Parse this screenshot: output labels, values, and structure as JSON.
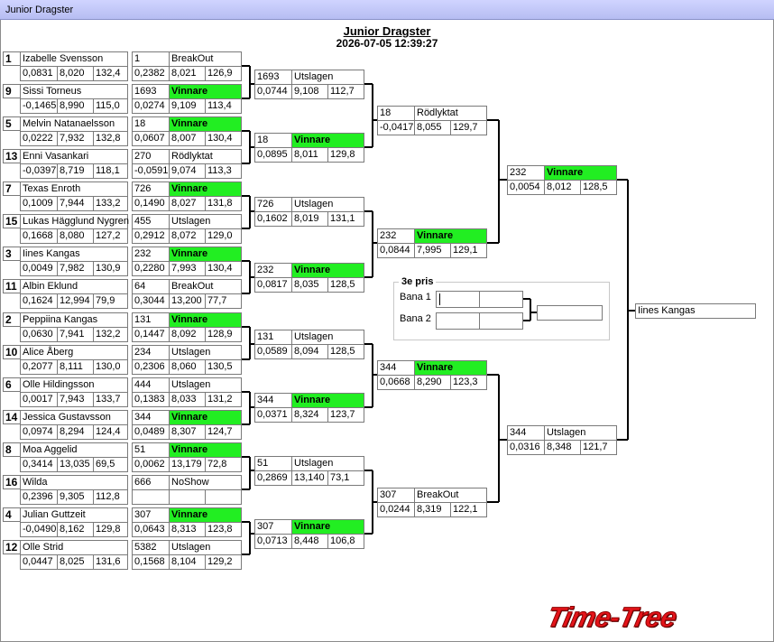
{
  "window": {
    "title": "Junior Dragster"
  },
  "header": {
    "title": "Junior Dragster",
    "datetime": "2026-07-05 12:39:27"
  },
  "round1": [
    {
      "seed": "1",
      "name": "Izabelle Svensson",
      "rt": "0,0831",
      "et": "8,020",
      "speed": "132,4"
    },
    {
      "seed": "9",
      "name": "Sissi Torneus",
      "rt": "-0,1465",
      "et": "8,990",
      "speed": "115,0"
    },
    {
      "seed": "5",
      "name": "Melvin Natanaelsson",
      "rt": "0,0222",
      "et": "7,932",
      "speed": "132,8"
    },
    {
      "seed": "13",
      "name": "Enni Vasankari",
      "rt": "-0,0397",
      "et": "8,719",
      "speed": "118,1"
    },
    {
      "seed": "7",
      "name": "Texas Enroth",
      "rt": "0,1009",
      "et": "7,944",
      "speed": "133,2"
    },
    {
      "seed": "15",
      "name": "Lukas Hägglund Nygren",
      "rt": "0,1668",
      "et": "8,080",
      "speed": "127,2"
    },
    {
      "seed": "3",
      "name": "Iines Kangas",
      "rt": "0,0049",
      "et": "7,982",
      "speed": "130,9"
    },
    {
      "seed": "11",
      "name": "Albin Eklund",
      "rt": "0,1624",
      "et": "12,994",
      "speed": "79,9"
    },
    {
      "seed": "2",
      "name": "Peppiina Kangas",
      "rt": "0,0630",
      "et": "7,941",
      "speed": "132,2"
    },
    {
      "seed": "10",
      "name": "Alice Åberg",
      "rt": "0,2077",
      "et": "8,111",
      "speed": "130,0"
    },
    {
      "seed": "6",
      "name": "Olle Hildingsson",
      "rt": "0,0017",
      "et": "7,943",
      "speed": "133,7"
    },
    {
      "seed": "14",
      "name": "Jessica Gustavsson",
      "rt": "0,0974",
      "et": "8,294",
      "speed": "124,4"
    },
    {
      "seed": "8",
      "name": "Moa Aggelid",
      "rt": "0,3414",
      "et": "13,035",
      "speed": "69,5"
    },
    {
      "seed": "16",
      "name": "Wilda",
      "rt": "0,2396",
      "et": "9,305",
      "speed": "112,8"
    },
    {
      "seed": "4",
      "name": "Julian  Guttzeit",
      "rt": "-0,0490",
      "et": "8,162",
      "speed": "129,8"
    },
    {
      "seed": "12",
      "name": "Olle Strid",
      "rt": "0,0447",
      "et": "8,025",
      "speed": "131,6"
    }
  ],
  "round2": [
    {
      "num": "1",
      "status": "BreakOut",
      "win": false,
      "rt": "0,2382",
      "et": "8,021",
      "speed": "126,9"
    },
    {
      "num": "1693",
      "status": "Vinnare",
      "win": true,
      "rt": "0,0274",
      "et": "9,109",
      "speed": "113,4"
    },
    {
      "num": "18",
      "status": "Vinnare",
      "win": true,
      "rt": "0,0607",
      "et": "8,007",
      "speed": "130,4"
    },
    {
      "num": "270",
      "status": "Rödlyktat",
      "win": false,
      "rt": "-0,0591",
      "et": "9,074",
      "speed": "113,3"
    },
    {
      "num": "726",
      "status": "Vinnare",
      "win": true,
      "rt": "0,1490",
      "et": "8,027",
      "speed": "131,8"
    },
    {
      "num": "455",
      "status": "Utslagen",
      "win": false,
      "rt": "0,2912",
      "et": "8,072",
      "speed": "129,0"
    },
    {
      "num": "232",
      "status": "Vinnare",
      "win": true,
      "rt": "0,2280",
      "et": "7,993",
      "speed": "130,4"
    },
    {
      "num": "64",
      "status": "BreakOut",
      "win": false,
      "rt": "0,3044",
      "et": "13,200",
      "speed": "77,7"
    },
    {
      "num": "131",
      "status": "Vinnare",
      "win": true,
      "rt": "0,1447",
      "et": "8,092",
      "speed": "128,9"
    },
    {
      "num": "234",
      "status": "Utslagen",
      "win": false,
      "rt": "0,2306",
      "et": "8,060",
      "speed": "130,5"
    },
    {
      "num": "444",
      "status": "Utslagen",
      "win": false,
      "rt": "0,1383",
      "et": "8,033",
      "speed": "131,2"
    },
    {
      "num": "344",
      "status": "Vinnare",
      "win": true,
      "rt": "0,0489",
      "et": "8,307",
      "speed": "124,7"
    },
    {
      "num": "51",
      "status": "Vinnare",
      "win": true,
      "rt": "0,0062",
      "et": "13,179",
      "speed": "72,8"
    },
    {
      "num": "666",
      "status": "NoShow",
      "win": false,
      "rt": "",
      "et": "",
      "speed": ""
    },
    {
      "num": "307",
      "status": "Vinnare",
      "win": true,
      "rt": "0,0643",
      "et": "8,313",
      "speed": "123,8"
    },
    {
      "num": "5382",
      "status": "Utslagen",
      "win": false,
      "rt": "0,1568",
      "et": "8,104",
      "speed": "129,2"
    }
  ],
  "round3": [
    {
      "num": "1693",
      "status": "Utslagen",
      "win": false,
      "rt": "0,0744",
      "et": "9,108",
      "speed": "112,7"
    },
    {
      "num": "18",
      "status": "Vinnare",
      "win": true,
      "rt": "0,0895",
      "et": "8,011",
      "speed": "129,8"
    },
    {
      "num": "726",
      "status": "Utslagen",
      "win": false,
      "rt": "0,1602",
      "et": "8,019",
      "speed": "131,1"
    },
    {
      "num": "232",
      "status": "Vinnare",
      "win": true,
      "rt": "0,0817",
      "et": "8,035",
      "speed": "128,5"
    },
    {
      "num": "131",
      "status": "Utslagen",
      "win": false,
      "rt": "0,0589",
      "et": "8,094",
      "speed": "128,5"
    },
    {
      "num": "344",
      "status": "Vinnare",
      "win": true,
      "rt": "0,0371",
      "et": "8,324",
      "speed": "123,7"
    },
    {
      "num": "51",
      "status": "Utslagen",
      "win": false,
      "rt": "0,2869",
      "et": "13,140",
      "speed": "73,1"
    },
    {
      "num": "307",
      "status": "Vinnare",
      "win": true,
      "rt": "0,0713",
      "et": "8,448",
      "speed": "106,8"
    }
  ],
  "round4": [
    {
      "num": "18",
      "status": "Rödlyktat",
      "win": false,
      "rt": "-0,0417",
      "et": "8,055",
      "speed": "129,7"
    },
    {
      "num": "232",
      "status": "Vinnare",
      "win": true,
      "rt": "0,0844",
      "et": "7,995",
      "speed": "129,1"
    },
    {
      "num": "344",
      "status": "Vinnare",
      "win": true,
      "rt": "0,0668",
      "et": "8,290",
      "speed": "123,3"
    },
    {
      "num": "307",
      "status": "BreakOut",
      "win": false,
      "rt": "0,0244",
      "et": "8,319",
      "speed": "122,1"
    }
  ],
  "final": [
    {
      "num": "232",
      "status": "Vinnare",
      "win": true,
      "rt": "0,0054",
      "et": "8,012",
      "speed": "128,5"
    },
    {
      "num": "344",
      "status": "Utslagen",
      "win": false,
      "rt": "0,0316",
      "et": "8,348",
      "speed": "121,7"
    }
  ],
  "third_place": {
    "title": "3e pris",
    "lane1_label": "Bana 1",
    "lane2_label": "Bana 2",
    "lane1_value": "",
    "lane2_value": "",
    "result": ""
  },
  "champion": {
    "name": "Iines Kangas"
  },
  "branding": {
    "logo_text": "Time-Tree"
  },
  "colors": {
    "winner": "#22ee22",
    "logo": "#e4141a"
  }
}
